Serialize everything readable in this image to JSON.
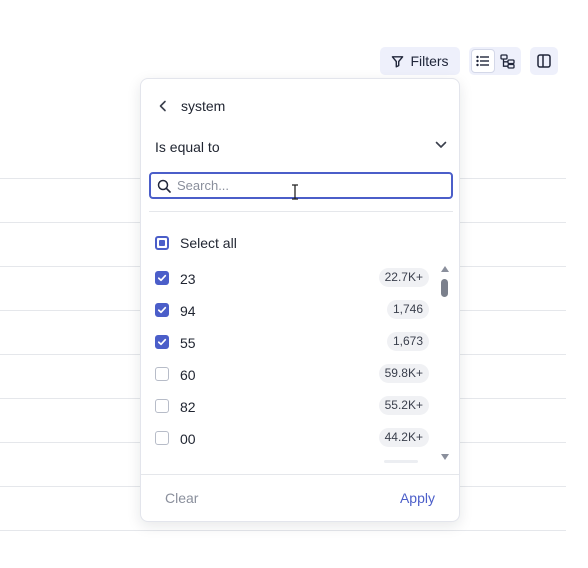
{
  "toolbar": {
    "filters_label": "Filters",
    "filters_icon": "funnel-icon",
    "list_view_icon": "list-icon",
    "tree_view_icon": "tree-icon",
    "panel_icon": "split-panel-icon"
  },
  "filter": {
    "field": "system",
    "operator": "Is equal to",
    "search": {
      "value": "",
      "placeholder": "Search..."
    },
    "select_all_label": "Select all",
    "select_all_state": "partial",
    "options": [
      {
        "value": "23",
        "count": "22.7K+",
        "checked": true
      },
      {
        "value": "94",
        "count": "1,746",
        "checked": true
      },
      {
        "value": "55",
        "count": "1,673",
        "checked": true
      },
      {
        "value": "60",
        "count": "59.8K+",
        "checked": false
      },
      {
        "value": "82",
        "count": "55.2K+",
        "checked": false
      },
      {
        "value": "00",
        "count": "44.2K+",
        "checked": false
      }
    ],
    "clear_label": "Clear",
    "apply_label": "Apply"
  },
  "colors": {
    "accent": "#4b5ec9",
    "toolbar_bg": "#eef0fb",
    "muted_text": "#8a8f9c"
  }
}
